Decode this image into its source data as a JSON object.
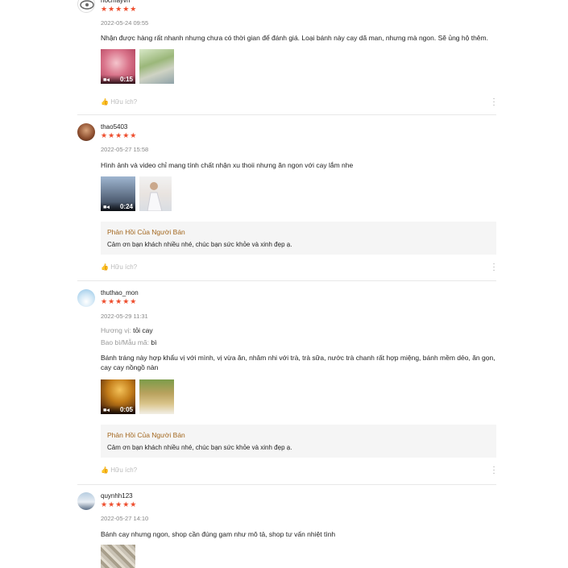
{
  "reviews": [
    {
      "username": "nocmayvn",
      "stars": "★★★★★",
      "date": "2022-05-24 09:55",
      "text": "Nhận được hàng rất nhanh nhưng chưa có thời gian để đánh giá. Loại bánh này cay dã man, nhưng mà ngon. Sẽ ủng hộ thêm.",
      "video_duration": "0:15",
      "helpful": "Hữu ích?"
    },
    {
      "username": "thao5403",
      "stars": "★★★★★",
      "date": "2022-05-27 15:58",
      "text": "Hình ảnh và video chỉ mang tính chất nhận xu thoii nhưng ăn ngon với cay lắm nhe",
      "video_duration": "0:24",
      "reply_title": "Phản Hồi Của Người Bán",
      "reply_text": "Cảm ơn bạn khách nhiều nhé, chúc bạn sức khỏe và xinh đẹp ạ.",
      "helpful": "Hữu ích?"
    },
    {
      "username": "thuthao_mon",
      "stars": "★★★★★",
      "date": "2022-05-29 11:31",
      "attr1_key": "Hương vị:",
      "attr1_val": "tỏi cay",
      "attr2_key": "Bao bì/Mẫu mã:",
      "attr2_val": "bì",
      "text": "Bánh tráng này hợp khẩu vị với mình, vị vừa ăn, nhâm nhi với trà, trà sữa, nước trà chanh rất hợp miệng, bánh mềm dẻo, ăn gọn, cay cay nồngồ nàn",
      "video_duration": "0:05",
      "reply_title": "Phản Hồi Của Người Bán",
      "reply_text": "Cảm ơn bạn khách nhiều nhé, chúc bạn sức khỏe và xinh đẹp ạ.",
      "helpful": "Hữu ích?"
    },
    {
      "username": "quynhh123",
      "stars": "★★★★★",
      "date": "2022-05-27 14:10",
      "text": "Bánh cay nhưng ngon, shop cần đúng gam như mô tả, shop tư vấn nhiệt tình"
    }
  ],
  "icons": {
    "video_camera": "video-camera-icon",
    "thumb_up": "thumb-up-icon",
    "more": "more-vertical-icon"
  },
  "colors": {
    "stars": "#ee4d2d",
    "reply_title": "#a3671e",
    "reply_bg": "#f5f5f5"
  }
}
